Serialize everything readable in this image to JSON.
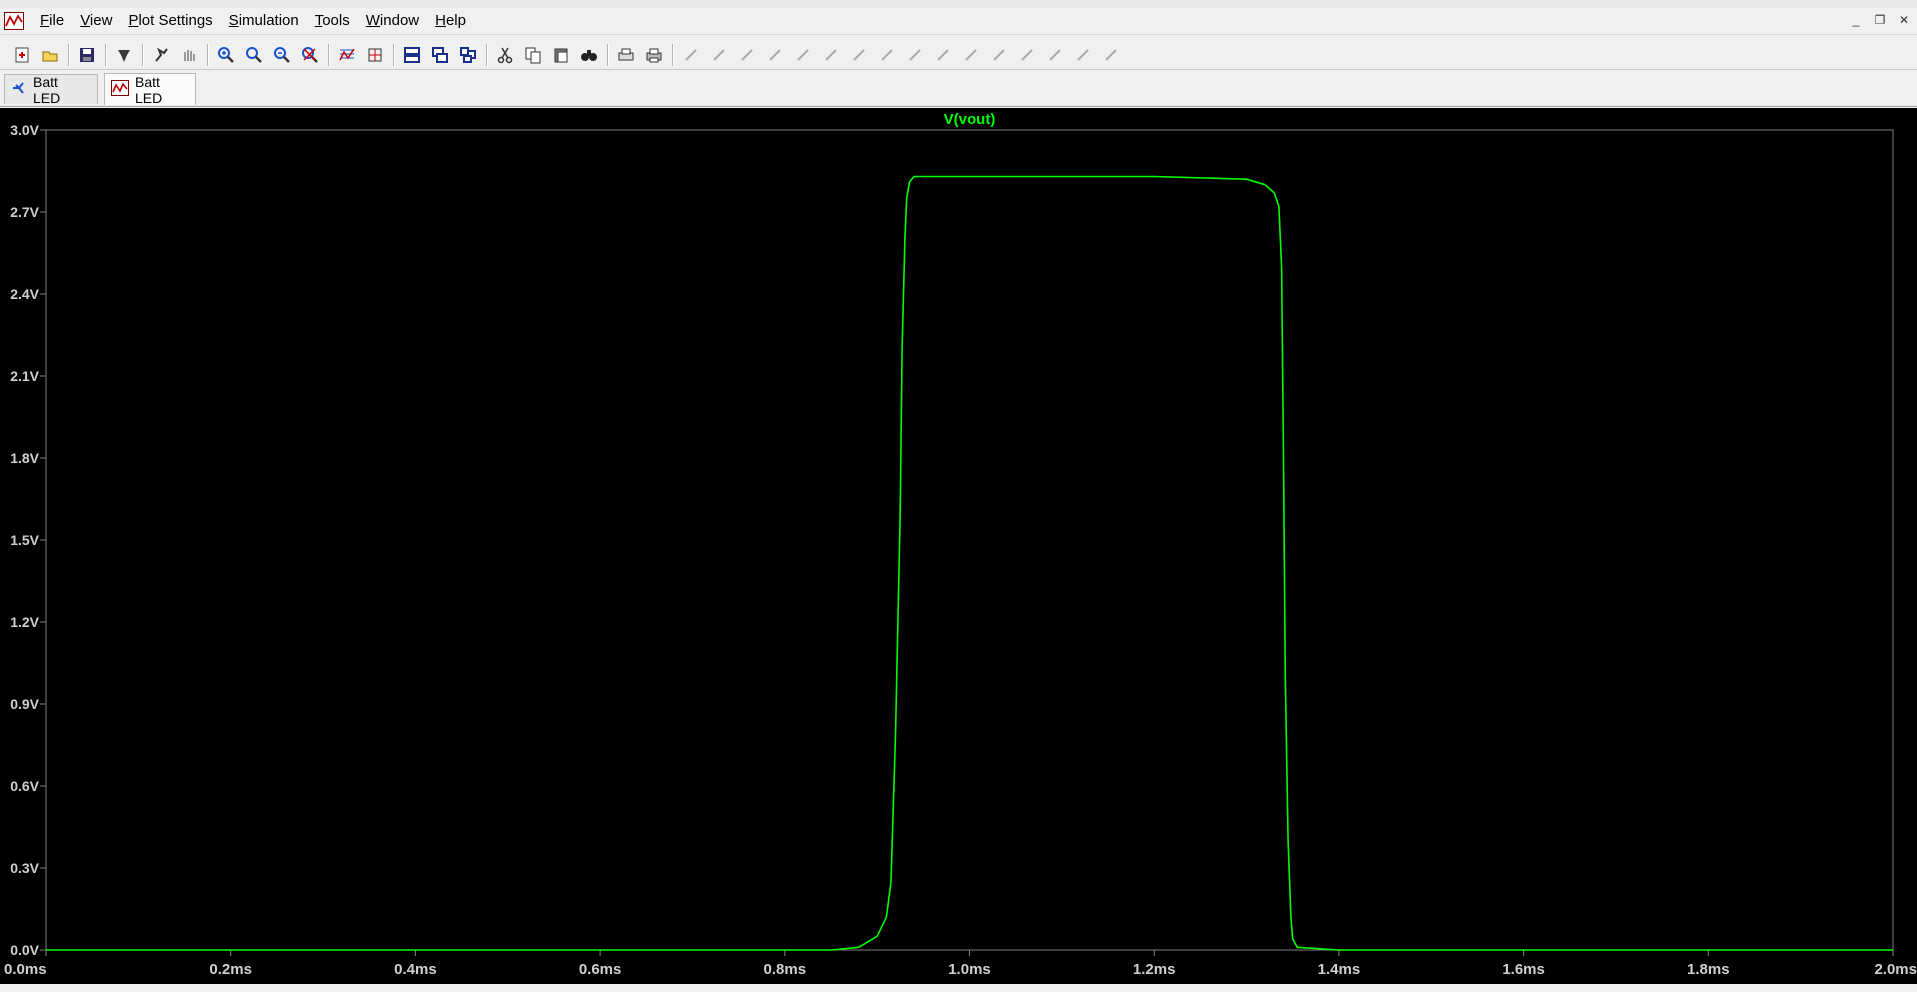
{
  "menu": {
    "items": [
      {
        "id": "file",
        "mnemonic": "F",
        "rest": "ile"
      },
      {
        "id": "view",
        "mnemonic": "V",
        "rest": "iew"
      },
      {
        "id": "plot-settings",
        "mnemonic": "P",
        "rest": "lot Settings"
      },
      {
        "id": "simulation",
        "mnemonic": "S",
        "rest": "imulation"
      },
      {
        "id": "tools",
        "mnemonic": "T",
        "rest": "ools"
      },
      {
        "id": "window",
        "mnemonic": "W",
        "rest": "indow"
      },
      {
        "id": "help",
        "mnemonic": "H",
        "rest": "elp"
      }
    ]
  },
  "window_controls": {
    "minimize": "_",
    "restore": "❐",
    "close": "✕"
  },
  "toolbar": {
    "groups": [
      [
        "new-schematic-icon",
        "open-icon"
      ],
      [
        "save-icon"
      ],
      [
        "control-panel-icon"
      ],
      [
        "run-icon",
        "halt-icon"
      ],
      [
        "zoom-in-icon",
        "zoom-area-icon",
        "zoom-out-icon",
        "zoom-fit-icon"
      ],
      [
        "autorange-icon",
        "zoom-full-icon"
      ],
      [
        "tile-horizontal-icon",
        "cascade-icon",
        "tile-vertical-icon"
      ],
      [
        "cut-icon",
        "copy-icon",
        "paste-icon",
        "find-icon"
      ],
      [
        "print-preview-icon",
        "print-icon"
      ],
      [
        "wire-icon",
        "ground-icon",
        "label-net-icon",
        "resistor-icon",
        "capacitor-icon",
        "inductor-icon",
        "diode-icon",
        "component-icon",
        "move-icon",
        "drag-icon",
        "undo-icon",
        "redo-icon",
        "rotate-icon",
        "mirror-icon",
        "text-icon",
        "spice-directive-icon"
      ]
    ]
  },
  "tabs": [
    {
      "label": "Batt LED",
      "kind": "schematic",
      "active": false
    },
    {
      "label": "Batt LED",
      "kind": "waveform",
      "active": true
    }
  ],
  "colors": {
    "trace": "#00ff00",
    "plot_bg": "#000000",
    "axis": "#808080",
    "tick_label": "#d0d0d0"
  },
  "chart_data": {
    "type": "line",
    "title": "V(vout)",
    "xlabel": "",
    "ylabel": "",
    "xlim": [
      0.0,
      2.0
    ],
    "ylim": [
      0.0,
      3.0
    ],
    "x_unit": "ms",
    "y_unit": "V",
    "x_ticks": [
      "0.0ms",
      "0.2ms",
      "0.4ms",
      "0.6ms",
      "0.8ms",
      "1.0ms",
      "1.2ms",
      "1.4ms",
      "1.6ms",
      "1.8ms",
      "2.0ms"
    ],
    "y_ticks": [
      "3.0V",
      "2.7V",
      "2.4V",
      "2.1V",
      "1.8V",
      "1.5V",
      "1.2V",
      "0.9V",
      "0.6V",
      "0.3V",
      "0.0V"
    ],
    "grid": false,
    "series": [
      {
        "name": "V(vout)",
        "x": [
          0.0,
          0.85,
          0.88,
          0.9,
          0.91,
          0.915,
          0.92,
          0.925,
          0.927,
          0.93,
          0.932,
          0.935,
          0.94,
          1.0,
          1.2,
          1.3,
          1.32,
          1.33,
          1.335,
          1.338,
          1.34,
          1.342,
          1.345,
          1.348,
          1.35,
          1.355,
          1.4,
          2.0
        ],
        "y": [
          0.0,
          0.0,
          0.01,
          0.05,
          0.12,
          0.25,
          0.8,
          1.6,
          2.2,
          2.6,
          2.75,
          2.81,
          2.83,
          2.83,
          2.83,
          2.82,
          2.8,
          2.77,
          2.72,
          2.5,
          1.8,
          1.0,
          0.4,
          0.12,
          0.04,
          0.01,
          0.0,
          0.0
        ]
      }
    ]
  }
}
